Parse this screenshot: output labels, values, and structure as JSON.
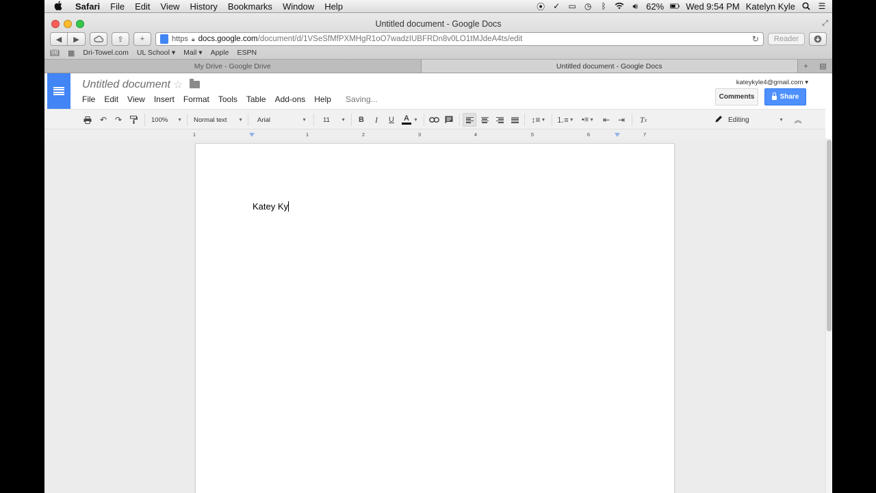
{
  "menubar": {
    "app_name": "Safari",
    "items": [
      "File",
      "Edit",
      "View",
      "History",
      "Bookmarks",
      "Window",
      "Help"
    ],
    "battery": "62%",
    "clock": "Wed 9:54 PM",
    "user": "Katelyn Kyle"
  },
  "window": {
    "title": "Untitled document - Google Docs",
    "address": {
      "scheme": "https",
      "domain": "docs.google.com",
      "path": "/document/d/1VSeSfMfPXMHgR1oO7wadzIUBFRDn8v0LO1tMJdeA4ts/edit"
    },
    "reader_label": "Reader"
  },
  "bookmarks": [
    "Dri-Towel.com",
    "UL School ▾",
    "Mail ▾",
    "Apple",
    "ESPN"
  ],
  "tabs": [
    {
      "label": "My Drive - Google Drive",
      "active": false
    },
    {
      "label": "Untitled document - Google Docs",
      "active": true
    }
  ],
  "docs": {
    "doc_title": "Untitled document",
    "menu": [
      "File",
      "Edit",
      "View",
      "Insert",
      "Format",
      "Tools",
      "Table",
      "Add-ons",
      "Help"
    ],
    "status": "Saving...",
    "account": "kateykyle4@gmail.com ▾",
    "comments_label": "Comments",
    "share_label": "Share"
  },
  "toolbar": {
    "zoom": "100%",
    "style": "Normal text",
    "font": "Arial",
    "size": "11",
    "mode": "Editing"
  },
  "ruler": {
    "labels": [
      "1",
      "1",
      "2",
      "3",
      "4",
      "5",
      "6",
      "7"
    ]
  },
  "document": {
    "text": "Katey Ky"
  }
}
